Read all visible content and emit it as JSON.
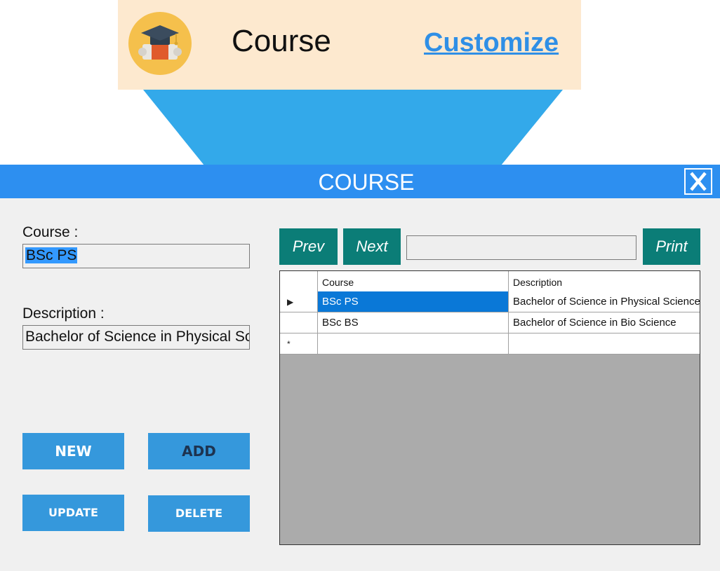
{
  "banner": {
    "title": "Course",
    "customize_link": "Customize",
    "icon": "graduation-cap-icon",
    "colors": {
      "background": "#fde9cf",
      "icon_circle": "#f5c04c",
      "link": "#2f8fe6"
    }
  },
  "funnel": {
    "color": "#33a9ea"
  },
  "window": {
    "title": "COURSE",
    "close_label": "X",
    "colors": {
      "titlebar": "#2d8ff0",
      "body": "#f0f0f0"
    }
  },
  "form": {
    "course_label": "Course :",
    "course_value": "BSc PS",
    "description_label": "Description :",
    "description_value": "Bachelor of Science in Physical Science"
  },
  "actions": {
    "new_label": "NEW",
    "add_label": "ADD",
    "update_label": "UPDATE",
    "delete_label": "DELETE",
    "color": "#3598dc"
  },
  "navigation": {
    "prev_label": "Prev",
    "next_label": "Next",
    "print_label": "Print",
    "page_box_value": "",
    "color": "#0b7d77"
  },
  "grid": {
    "columns": [
      "Course",
      "Description"
    ],
    "rows": [
      {
        "course": "BSc PS",
        "description": "Bachelor of Science in Physical Science",
        "current": true
      },
      {
        "course": "BSc BS",
        "description": "Bachelor of Science in Bio Science",
        "current": false
      }
    ],
    "new_row_marker": "*",
    "current_row_marker": "▶",
    "selection_color": "#0a78d7"
  }
}
